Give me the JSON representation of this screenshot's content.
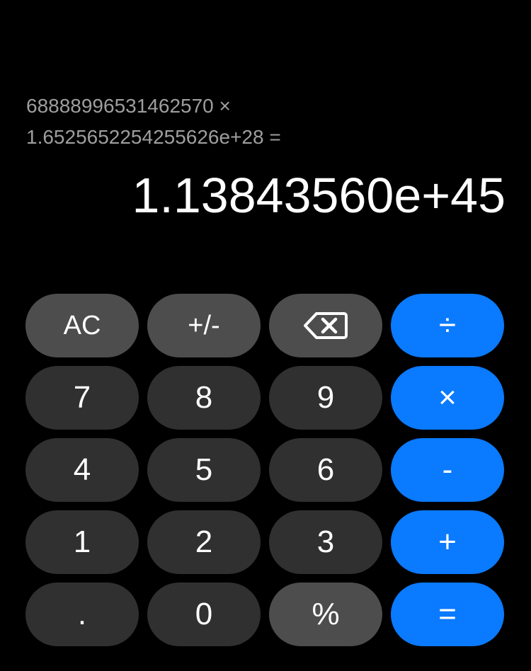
{
  "display": {
    "history_line_1": "68888996531462570 ×",
    "history_line_2": "1.6525652254255626e+28 =",
    "result": "1.13843560e+45"
  },
  "keys": {
    "clear": "AC",
    "negate": "+/-",
    "backspace_icon": "backspace-icon",
    "divide": "÷",
    "seven": "7",
    "eight": "8",
    "nine": "9",
    "multiply": "×",
    "four": "4",
    "five": "5",
    "six": "6",
    "subtract": "-",
    "one": "1",
    "two": "2",
    "three": "3",
    "add": "+",
    "decimal": ".",
    "zero": "0",
    "percent": "%",
    "equals": "="
  },
  "colors": {
    "background": "#000000",
    "digit_key": "#303030",
    "function_key": "#4d4d4d",
    "operator_key": "#0a7aff",
    "history_text": "#9e9e9e"
  }
}
